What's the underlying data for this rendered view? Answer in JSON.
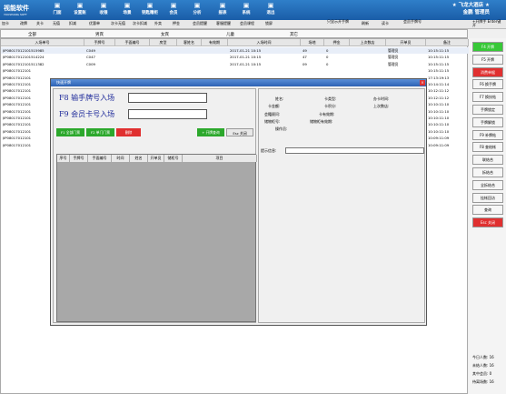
{
  "app": {
    "logo_text": "视能软件",
    "logo_sub": "YOUSHANG SOFT",
    "hotel_name": "★ 飞龙大酒店 ★",
    "user": "金鹏  管理员"
  },
  "top_buttons": [
    {
      "label": "门面",
      "icon": "door-icon"
    },
    {
      "label": "设置账",
      "icon": "settings-icon"
    },
    {
      "label": "收银",
      "icon": "cash-icon"
    },
    {
      "label": "场景",
      "icon": "scene-icon"
    },
    {
      "label": "钥匙赠柜",
      "icon": "key-icon"
    },
    {
      "label": "会员",
      "icon": "member-icon"
    },
    {
      "label": "分析",
      "icon": "chart-icon"
    },
    {
      "label": "报表",
      "icon": "report-icon"
    },
    {
      "label": "系统",
      "icon": "system-icon"
    },
    {
      "label": "退出",
      "icon": "exit-icon"
    }
  ],
  "toolbar2": [
    "加卡",
    "改牌",
    "关卡",
    "无值",
    "扣减",
    "优惠单",
    "次卡无值",
    "次卡扣减",
    "外卖",
    "押金",
    "会员提醒",
    "客服提醒",
    "会员课程",
    "锁屏"
  ],
  "toolbar2_right": {
    "filter_label": "只显示开手牌",
    "refresh": "刷新",
    "reader": "读卡",
    "member_no": "会员手牌号",
    "open": "+开牌手 Enter键开"
  },
  "categories": [
    "全部",
    "男宾",
    "女宾",
    "儿童",
    "其它"
  ],
  "table": {
    "headers": [
      "入场单号",
      "手牌号",
      "手面编号",
      "房型",
      "客姓名",
      "有效期",
      "入场时间",
      "场地",
      "押金",
      "上次数店",
      "开单员",
      "备注"
    ],
    "rows": [
      [
        "JIP08017012101515985",
        "C049",
        "",
        "",
        "",
        "",
        "2017-01-21 10:15",
        "49",
        "0",
        "",
        "管理员",
        "10:15:11:15"
      ],
      [
        "JIP08017012101514224",
        "C047",
        "",
        "",
        "",
        "",
        "2017-01-21 10:15",
        "47",
        "0",
        "",
        "管理员",
        "10:15:11:15"
      ],
      [
        "JIP08017012101511382",
        "C009",
        "",
        "",
        "",
        "",
        "2017-01-21 10:15",
        "09",
        "0",
        "",
        "管理员",
        "10:15:11:15"
      ],
      [
        "JIP08017012101",
        "",
        "",
        "",
        "",
        "",
        "",
        "",
        "",
        "",
        "",
        "10:15:11:15"
      ],
      [
        "JIP08017012101",
        "",
        "",
        "",
        "",
        "",
        "",
        "",
        "",
        "",
        "",
        "17:13:19:13"
      ],
      [
        "JIP08017012101",
        "",
        "",
        "",
        "",
        "",
        "",
        "",
        "",
        "",
        "",
        "10:14:11:14"
      ],
      [
        "JIP08017012101",
        "",
        "",
        "",
        "",
        "",
        "",
        "",
        "",
        "",
        "",
        "10:12:11:12"
      ],
      [
        "JIP08017012101",
        "",
        "",
        "",
        "",
        "",
        "",
        "",
        "",
        "",
        "",
        "10:12:11:12"
      ],
      [
        "JIP08017012101",
        "",
        "",
        "",
        "",
        "",
        "",
        "",
        "",
        "",
        "",
        "10:10:11:10"
      ],
      [
        "JIP08017012101",
        "",
        "",
        "",
        "",
        "",
        "",
        "",
        "",
        "",
        "",
        "10:10:11:10"
      ],
      [
        "JIP08017012101",
        "",
        "",
        "",
        "",
        "",
        "",
        "",
        "",
        "",
        "",
        "10:10:11:10"
      ],
      [
        "JIP08017012101",
        "",
        "",
        "",
        "",
        "",
        "",
        "",
        "",
        "",
        "",
        "10:10:11:10"
      ],
      [
        "JIP08017012101",
        "",
        "",
        "",
        "",
        "",
        "",
        "",
        "",
        "",
        "",
        "10:10:11:10"
      ],
      [
        "JIP08017012101",
        "",
        "",
        "",
        "",
        "",
        "",
        "",
        "",
        "",
        "",
        "10:09:11:09"
      ],
      [
        "JIP08017012101",
        "",
        "",
        "",
        "",
        "",
        "",
        "",
        "",
        "",
        "",
        "10:09:11:09"
      ]
    ]
  },
  "right_panel": {
    "buttons": [
      {
        "label": "F4 开牌",
        "style": "g"
      },
      {
        "label": "F5 开牌",
        "style": ""
      },
      {
        "label": "消费单据",
        "style": "r"
      },
      {
        "label": "F6 换手牌",
        "style": ""
      },
      {
        "label": "F7 换技帖",
        "style": ""
      },
      {
        "label": "手牌锁定",
        "style": ""
      },
      {
        "label": "手牌解锁",
        "style": ""
      },
      {
        "label": "F9 补牌帖",
        "style": ""
      },
      {
        "label": "F8 查结帐",
        "style": ""
      },
      {
        "label": "联结合",
        "style": ""
      },
      {
        "label": "拆结合",
        "style": ""
      },
      {
        "label": "全拆结合",
        "style": ""
      },
      {
        "label": "挂帐回访",
        "style": ""
      },
      {
        "label": "查询",
        "style": ""
      },
      {
        "label": "Esc 关闭",
        "style": "r"
      }
    ],
    "stats": [
      "今日人数: 16",
      "未结人数: 16",
      "其中会员: 0",
      "待离场数: 16"
    ]
  },
  "dialog": {
    "title": "快速开牌",
    "close": "×",
    "f8_label": "F8 输手牌号入场",
    "f9_label": "F9 会员卡号入场",
    "f8_value": "",
    "f9_value": "",
    "btn_sauna": "F1 全部门票",
    "btn_single": "F2 单门门票",
    "btn_del": "删除",
    "btn_add": "+ 开牌查询",
    "btn_close": "Esc 关闭",
    "grid_headers": [
      "序号",
      "手牌号",
      "手面编号",
      "时间",
      "姓名",
      "开单员",
      "储柜号",
      "项目"
    ],
    "info": [
      {
        "label": "姓名:",
        "value": ""
      },
      {
        "label": "卡类型:",
        "value": ""
      },
      {
        "label": "办卡时间:",
        "value": ""
      },
      {
        "label": "卡金额:",
        "value": ""
      },
      {
        "label": "卡积分:",
        "value": ""
      },
      {
        "label": "上次数店:",
        "value": ""
      },
      {
        "label": "会籍顾问:",
        "value": ""
      },
      {
        "label": "卡有效期:",
        "value": ""
      },
      {
        "label": "储物柜号:",
        "value": ""
      },
      {
        "label": "储物柜有效期:",
        "value": ""
      },
      {
        "label": "操作员:",
        "value": ""
      }
    ],
    "hint_label": "提示信息:"
  }
}
